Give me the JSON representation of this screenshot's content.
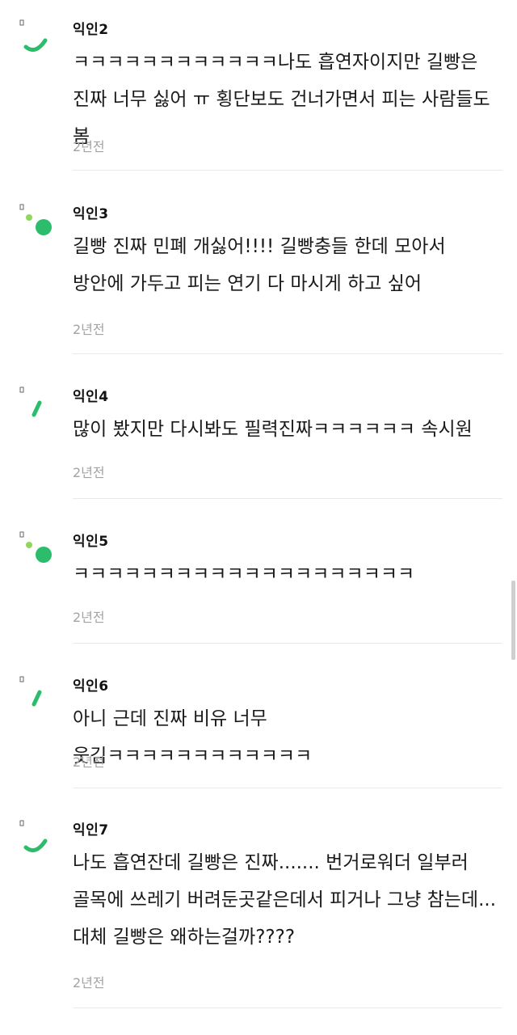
{
  "colors": {
    "accent": "#2bbd6b",
    "accent_light": "#8fd85a",
    "time": "#a3a3a3",
    "divider": "#e9e9e9"
  },
  "comments": [
    {
      "author": "익인2",
      "avatar_icon": "green-arc-icon",
      "text": "ㅋㅋㅋㅋㅋㅋㅋㅋㅋㅋㅋㅋ나도 흡연자이지만 길빵은 진짜 너무 싫어 ㅠ 횡단보도 건너가면서 피는 사람들도 봄",
      "time": "2년전"
    },
    {
      "author": "익인3",
      "avatar_icon": "green-dots-icon",
      "text": "길빵 진짜 민폐 개싫어!!!! 길빵충들 한데 모아서 방안에 가두고 피는 연기 다 마시게 하고 싶어",
      "time": "2년전"
    },
    {
      "author": "익인4",
      "avatar_icon": "green-slash-icon",
      "text": "많이 봤지만 다시봐도 필력진짜ㅋㅋㅋㅋㅋㅋ 속시원",
      "time": "2년전"
    },
    {
      "author": "익인5",
      "avatar_icon": "green-dots-icon",
      "text": "ㅋㅋㅋㅋㅋㅋㅋㅋㅋㅋㅋㅋㅋㅋㅋㅋㅋㅋㅋㅋ",
      "time": "2년전"
    },
    {
      "author": "익인6",
      "avatar_icon": "green-slash-icon",
      "text": "아니 근데 진짜 비유 너무 웃김ㅋㅋㅋㅋㅋㅋㅋㅋㅋㅋㅋㅋ",
      "time": "2년전"
    },
    {
      "author": "익인7",
      "avatar_icon": "green-arc-icon",
      "text": "나도 흡연잔데 길빵은 진짜....... 번거로워더 일부러 골목에 쓰레기 버려둔곳같은데서 피거나 그냥 참는데... 대체 길빵은 왜하는걸까????",
      "time": "2년전"
    }
  ]
}
